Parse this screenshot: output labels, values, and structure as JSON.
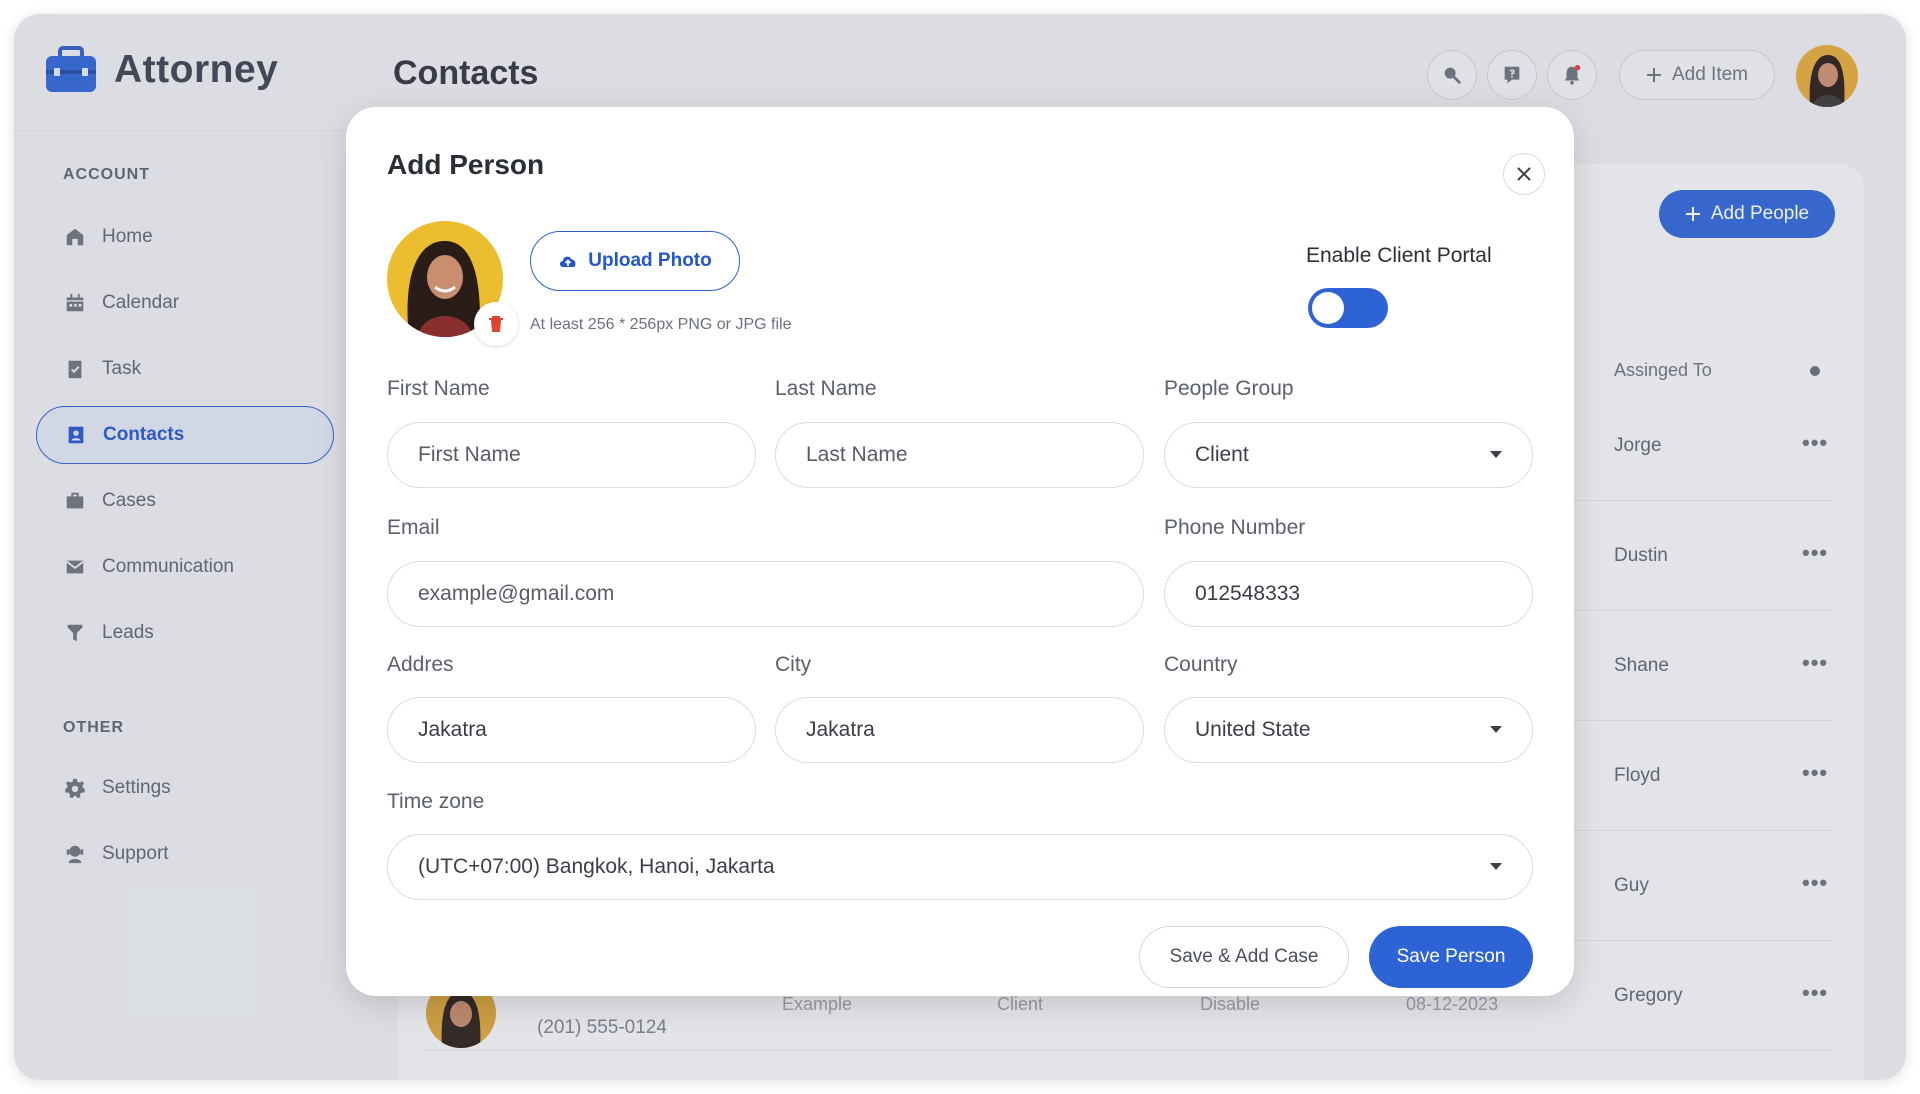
{
  "app": {
    "name": "Attorney"
  },
  "sidebar": {
    "account_heading": "ACCOUNT",
    "items": [
      {
        "label": "Home"
      },
      {
        "label": "Calendar"
      },
      {
        "label": "Task"
      },
      {
        "label": "Contacts"
      },
      {
        "label": "Cases"
      },
      {
        "label": "Communication"
      },
      {
        "label": "Leads"
      }
    ],
    "other_heading": "OTHER",
    "other_items": [
      {
        "label": "Settings"
      },
      {
        "label": "Support"
      }
    ]
  },
  "header": {
    "title": "Contacts",
    "add_item_label": "Add Item"
  },
  "background_table": {
    "add_people_label": "Add People",
    "assigned_header": "Assinged To",
    "rows": [
      {
        "assigned": "Jorge"
      },
      {
        "assigned": "Dustin"
      },
      {
        "assigned": "Shane"
      },
      {
        "assigned": "Floyd"
      },
      {
        "assigned": "Guy"
      },
      {
        "assigned": "Gregory"
      }
    ],
    "more_symbol": "•••",
    "partial_phone": "(201) 555-0124",
    "partial_cells": [
      "Example",
      "Client",
      "Disable",
      "08-12-2023"
    ]
  },
  "modal": {
    "title": "Add Person",
    "upload_label": "Upload Photo",
    "upload_hint": "At least 256 * 256px PNG or JPG file",
    "portal_label": "Enable Client Portal",
    "portal_enabled": true,
    "fields": {
      "first_name": {
        "label": "First Name",
        "placeholder": "First Name",
        "value": ""
      },
      "last_name": {
        "label": "Last Name",
        "placeholder": "Last Name",
        "value": ""
      },
      "people_group": {
        "label": "People Group",
        "value": "Client"
      },
      "email": {
        "label": "Email",
        "placeholder": "example@gmail.com",
        "value": ""
      },
      "phone": {
        "label": "Phone Number",
        "value": "012548333"
      },
      "address": {
        "label": "Addres",
        "value": "Jakatra"
      },
      "city": {
        "label": "City",
        "value": "Jakatra"
      },
      "country": {
        "label": "Country",
        "value": "United State"
      },
      "timezone": {
        "label": "Time zone",
        "value": "(UTC+07:00) Bangkok, Hanoi, Jakarta"
      }
    },
    "save_add_case_label": "Save & Add Case",
    "save_person_label": "Save Person"
  },
  "colors": {
    "accent": "#2E63D6",
    "background": "#E9EBEE",
    "modal": "#FFFFFF"
  },
  "icons": [
    "briefcase-logo-icon",
    "home-icon",
    "calendar-icon",
    "task-icon",
    "contacts-icon",
    "cases-icon",
    "mail-icon",
    "funnel-icon",
    "gear-icon",
    "support-icon",
    "search-icon",
    "chat-icon",
    "bell-icon",
    "plus-icon",
    "close-icon",
    "cloud-upload-icon",
    "trash-icon",
    "chevron-down-icon"
  ]
}
